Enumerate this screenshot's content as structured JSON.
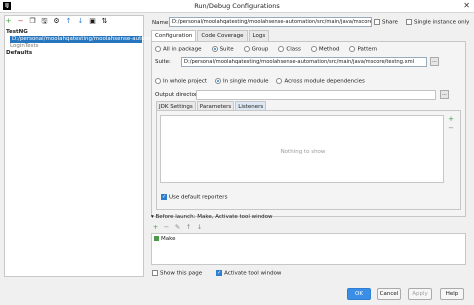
{
  "window": {
    "title": "Run/Debug Configurations",
    "app_icon_text": "IJ",
    "close": "✕"
  },
  "toolbar": [
    "+",
    "−",
    "❐",
    "🖫",
    "⚙",
    "↑",
    "↓",
    "▣",
    "⇅"
  ],
  "tree": [
    {
      "label": "TestNG",
      "kind": "bold"
    },
    {
      "label": "D:/personal/moolahqatesting/moolahsense-automation",
      "kind": "selected"
    },
    {
      "label": "LoginTests",
      "kind": "sub"
    },
    {
      "label": "Defaults",
      "kind": "bold"
    }
  ],
  "config": {
    "name_label": "Name:",
    "name_value": "D:/personal/moolahqatesting/moolahsense-automation/src/main/java/mscore/",
    "share_label": "Share",
    "single_label": "Single instance only",
    "tabs": [
      "Configuration",
      "Code Coverage",
      "Logs"
    ],
    "test_kinds": [
      "All in package",
      "Suite",
      "Group",
      "Class",
      "Method",
      "Pattern"
    ],
    "selected_kind": "Suite",
    "suite_label": "Suite:",
    "suite_value": "D:/personal/moolahqatesting/moolahsense-automation/src/main/java/mscore/testng.xml",
    "scope": [
      "In whole project",
      "In single module",
      "Across module dependencies"
    ],
    "selected_scope": "In single module",
    "output_label": "Output directory:",
    "browse": "...",
    "subtabs": [
      "JDK Settings",
      "Parameters",
      "Listeners"
    ],
    "active_subtab": "Listeners",
    "empty_text": "Nothing to show",
    "list_buttons": [
      "+",
      "−"
    ],
    "use_default": "Use default reporters"
  },
  "before_launch": {
    "label": "Before launch: Make, Activate tool window",
    "toolbar": [
      "+",
      "−",
      "✎",
      "↑",
      "↓"
    ],
    "item": "Make"
  },
  "options": {
    "show_page": "Show this page",
    "activate": "Activate tool window"
  },
  "buttons": {
    "ok": "OK",
    "cancel": "Cancel",
    "apply": "Apply",
    "help": "Help"
  },
  "colors": {
    "selection": "#2675bf",
    "primary": "#3a8ee6",
    "add_green": "#3c9c3c"
  }
}
